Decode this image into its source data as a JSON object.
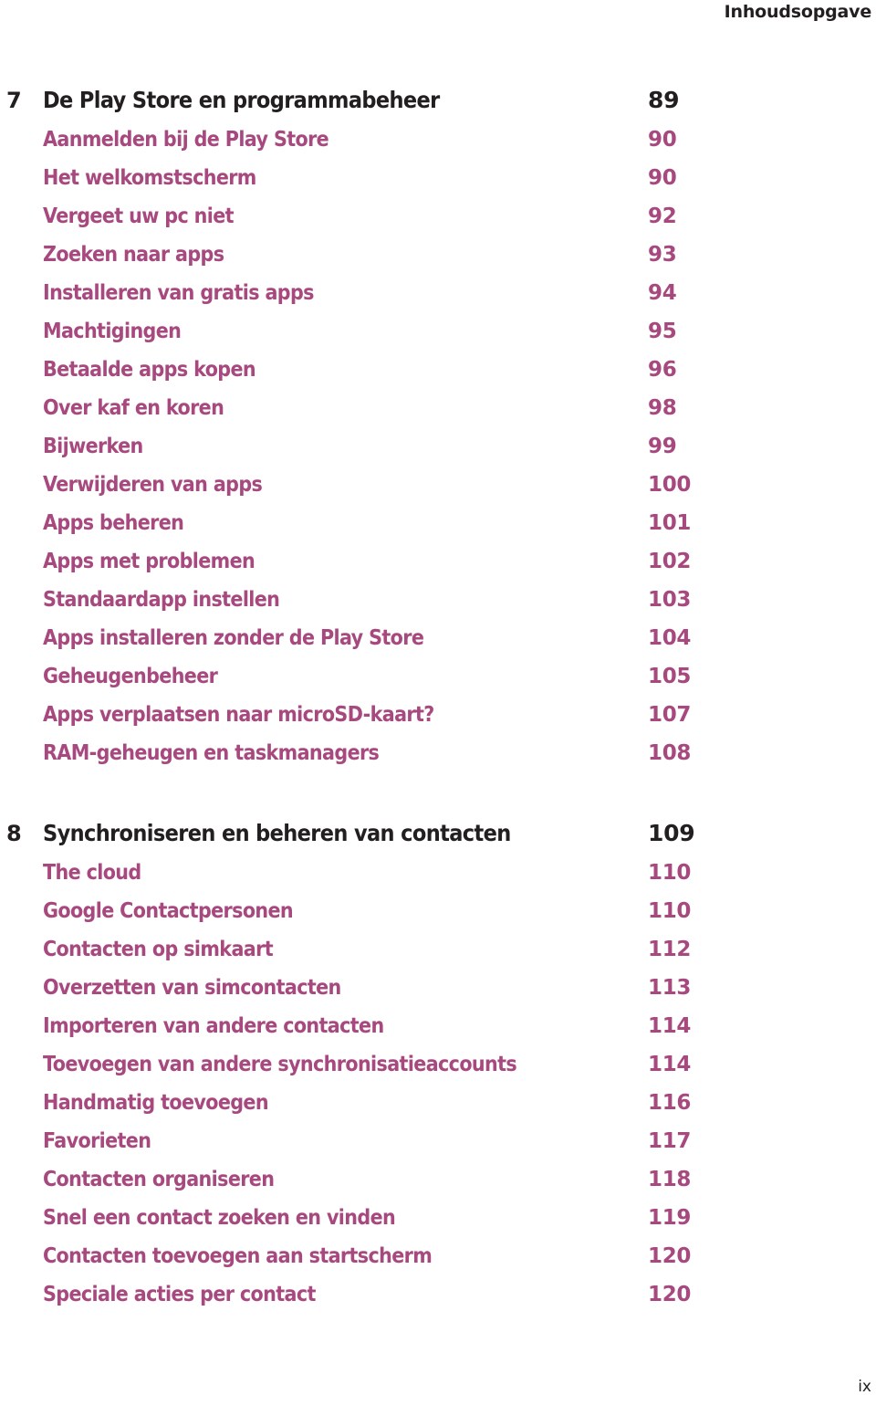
{
  "page": {
    "running_head": "Inhoudsopgave",
    "folio": "ix",
    "accent_color": "#a7497f",
    "text_color": "#231f20"
  },
  "toc": {
    "groups": [
      {
        "chapter": {
          "number": "7",
          "title": "De Play Store en programmabeheer",
          "page": "89"
        },
        "entries": [
          {
            "title": "Aanmelden bij de Play Store",
            "page": "90"
          },
          {
            "title": "Het welkomstscherm",
            "page": "90"
          },
          {
            "title": "Vergeet uw pc niet",
            "page": "92"
          },
          {
            "title": "Zoeken naar apps",
            "page": "93"
          },
          {
            "title": "Installeren van gratis apps",
            "page": "94"
          },
          {
            "title": "Machtigingen",
            "page": "95"
          },
          {
            "title": "Betaalde apps kopen",
            "page": "96"
          },
          {
            "title": "Over kaf en koren",
            "page": "98"
          },
          {
            "title": "Bijwerken",
            "page": "99"
          },
          {
            "title": "Verwijderen van apps",
            "page": "100"
          },
          {
            "title": "Apps beheren",
            "page": "101"
          },
          {
            "title": "Apps met problemen",
            "page": "102"
          },
          {
            "title": "Standaardapp instellen",
            "page": "103"
          },
          {
            "title": "Apps installeren zonder de Play Store",
            "page": "104"
          },
          {
            "title": "Geheugenbeheer",
            "page": "105"
          },
          {
            "title": "Apps verplaatsen naar microSD-kaart?",
            "page": "107"
          },
          {
            "title": "RAM-geheugen en taskmanagers",
            "page": "108"
          }
        ]
      },
      {
        "chapter": {
          "number": "8",
          "title": "Synchroniseren en beheren van contacten",
          "page": "109"
        },
        "entries": [
          {
            "title": "The cloud",
            "page": "110"
          },
          {
            "title": "Google Contactpersonen",
            "page": "110"
          },
          {
            "title": "Contacten op simkaart",
            "page": "112"
          },
          {
            "title": "Overzetten van simcontacten",
            "page": "113"
          },
          {
            "title": "Importeren van andere contacten",
            "page": "114"
          },
          {
            "title": "Toevoegen van andere synchronisatieaccounts",
            "page": "114"
          },
          {
            "title": "Handmatig toevoegen",
            "page": "116"
          },
          {
            "title": "Favorieten",
            "page": "117"
          },
          {
            "title": "Contacten organiseren",
            "page": "118"
          },
          {
            "title": "Snel een contact zoeken en vinden",
            "page": "119"
          },
          {
            "title": "Contacten toevoegen aan startscherm",
            "page": "120"
          },
          {
            "title": "Speciale acties per contact",
            "page": "120"
          }
        ]
      }
    ]
  }
}
